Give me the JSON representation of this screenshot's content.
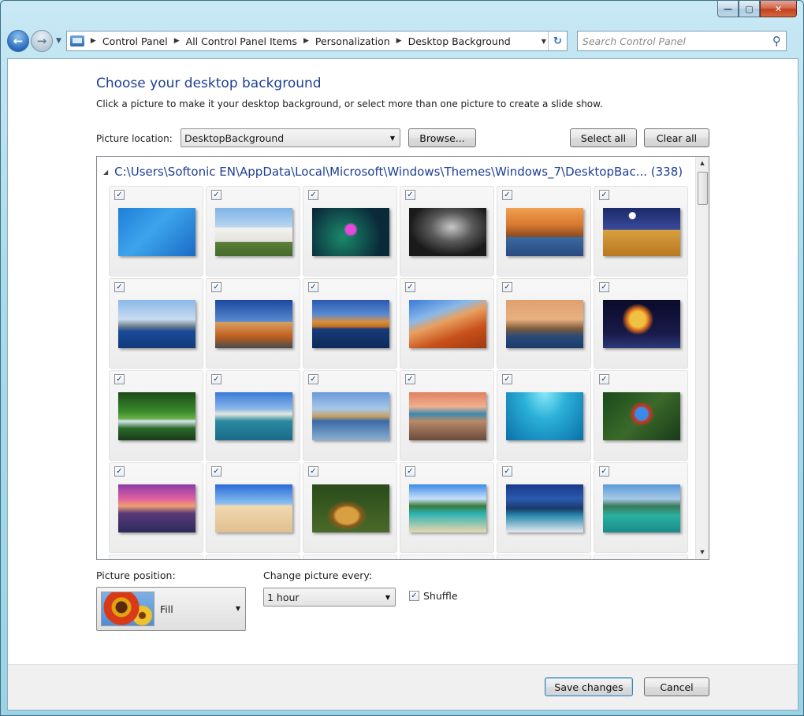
{
  "window": {
    "minimize_glyph": "—",
    "maximize_glyph": "▢",
    "close_glyph": "✕"
  },
  "nav": {
    "back_glyph": "←",
    "forward_glyph": "→",
    "breadcrumbs": [
      "Control Panel",
      "All Control Panel Items",
      "Personalization",
      "Desktop Background"
    ],
    "search_placeholder": "Search Control Panel"
  },
  "page": {
    "heading": "Choose your desktop background",
    "subtext": "Click a picture to make it your desktop background, or select more than one picture to create a slide show.",
    "picture_location_label": "Picture location:",
    "picture_location_value": "DesktopBackground",
    "browse_label": "Browse...",
    "select_all_label": "Select all",
    "clear_all_label": "Clear all"
  },
  "gallery": {
    "group_path": "C:\\Users\\Softonic EN\\AppData\\Local\\Microsoft\\Windows\\Themes\\Windows_7\\DesktopBac... (338)",
    "check_glyph": "✓",
    "thumbnails": [
      {
        "name": "windows-logo-thumbnail",
        "bg": "linear-gradient(135deg,#1f7fd8 0%,#3da4ec 45%,#1a6bc6 100%)"
      },
      {
        "name": "white-houses-thumbnail",
        "bg": "linear-gradient(180deg,#7fb2e6 0%,#b9d6f0 40%,#f2f2f0 41%,#e4e2dc 70%,#5b7f3a 71%,#456a2a 100%)"
      },
      {
        "name": "neon-light-thumbnail",
        "bg": "radial-gradient(circle at 50% 45%,#e64adc 0 6px,transparent 9px),radial-gradient(circle at 40% 60%,#1a8a6a,#0a2a3a 70%)"
      },
      {
        "name": "dark-curve-thumbnail",
        "bg": "radial-gradient(ellipse at 55% 40%,#c8c8c8 0%,#5a5a5a 35%,#1a1a1a 70%)"
      },
      {
        "name": "coastal-rocks-thumbnail",
        "bg": "linear-gradient(180deg,#f0a050 0%,#d87830 35%,#8a4a20 60%,#3a6aa0 61%,#2a4a80 100%)"
      },
      {
        "name": "desert-pinnacles-thumbnail",
        "bg": "radial-gradient(circle at 38% 16%,#ffffff 0 4px,transparent 5px),linear-gradient(180deg,#1a2a6a 0%,#3a4a9a 45%,#d8a040 46%,#b87820 100%)"
      },
      {
        "name": "city-harbor-thumbnail",
        "bg": "linear-gradient(180deg,#8ab8e8 0%,#c8dcef 40%,#6a7a8a 55%,#1a4a9a 65%,#123a7a 100%)"
      },
      {
        "name": "outback-road-thumbnail",
        "bg": "linear-gradient(180deg,#1a4aa0 0%,#5a8ad0 45%,#d8a060 46%,#c06020 75%,#4a4a4a 100%)"
      },
      {
        "name": "lake-reflection-thumbnail",
        "bg": "linear-gradient(180deg,#2a5ab0 0%,#5a8ad0 30%,#d89040 45%,#c07020 55%,#1a3a7a 60%,#0a2a5a 100%)"
      },
      {
        "name": "red-dunes-thumbnail",
        "bg": "linear-gradient(160deg,#3a7ad8 0%,#8ab8e8 30%,#e8a060 45%,#c8501a 70%,#a03a10 100%)"
      },
      {
        "name": "baobab-trees-thumbnail",
        "bg": "linear-gradient(180deg,#e0a070 0%,#e8b080 40%,#7a5a3a 60%,#2a4a7a 75%,#1a3a6a 100%)"
      },
      {
        "name": "fireworks-thumbnail",
        "bg": "radial-gradient(circle at 45% 40%,#f0c040 0 10px,#d86a1a 14px,transparent 20px),linear-gradient(180deg,#0a0a2a 0%,#1a1a4a 70%,#2a3a7a 100%)"
      },
      {
        "name": "rainforest-stream-thumbnail",
        "bg": "linear-gradient(180deg,#1a4a1a 0%,#3a8a2a 40%,#6ab04a 55%,#d8e8f0 60%,#2a6a2a 75%,#1a3a1a 100%)"
      },
      {
        "name": "sydney-harbor-thumbnail",
        "bg": "linear-gradient(180deg,#3a7ad8 0%,#8ab8e8 35%,#e8e8e0 45%,#2a8aa0 60%,#1a6a8a 100%)"
      },
      {
        "name": "apostles-coast-thumbnail",
        "bg": "linear-gradient(180deg,#6a9ad8 0%,#a8c8e8 35%,#c8a060 50%,#3a6aa8 60%,#8ab0d0 100%)"
      },
      {
        "name": "rocky-shore-thumbnail",
        "bg": "linear-gradient(180deg,#e08060 0%,#f0b090 30%,#3a8ab0 45%,#b88a6a 60%,#6a4a3a 100%)"
      },
      {
        "name": "underwater-thumbnail",
        "bg": "radial-gradient(ellipse at 50% 0%,#8ae8f8 0%,#2ab0d8 40%,#0a70a8 100%)"
      },
      {
        "name": "parrot-thumbnail",
        "bg": "radial-gradient(circle at 50% 45%,#3a8ae8 0 8px,#d83020 10px,transparent 16px),linear-gradient(135deg,#1a4a1a 0%,#3a6a2a 50%,#1a3a1a 100%)"
      },
      {
        "name": "sunset-bay-thumbnail",
        "bg": "linear-gradient(180deg,#8a3aa8 0%,#e060a0 30%,#f0a070 45%,#5a3a7a 60%,#2a2a5a 100%)"
      },
      {
        "name": "sand-palms-thumbnail",
        "bg": "linear-gradient(180deg,#2a6ad8 0%,#8ac0f0 40%,#f0d8b0 45%,#e0c090 100%)"
      },
      {
        "name": "leopard-thumbnail",
        "bg": "radial-gradient(ellipse at 45% 65%,#d8a040 0 14px,#8a5a1a 18px,transparent 26px),linear-gradient(180deg,#2a4a1a 0%,#4a6a2a 100%)"
      },
      {
        "name": "tropical-beach-thumbnail",
        "bg": "linear-gradient(180deg,#3a8ae8 0%,#c8e0f8 30%,#3a7a3a 45%,#2ab0b0 60%,#e8d8b0 100%)"
      },
      {
        "name": "coastal-city-thumbnail",
        "bg": "linear-gradient(180deg,#1a3a8a 0%,#2a5ab0 30%,#1a3a6a 50%,#2a8ab0 65%,#e8e8f0 100%)"
      },
      {
        "name": "island-lagoon-thumbnail",
        "bg": "linear-gradient(180deg,#5a9ad8 0%,#a8c8e8 30%,#3a7a5a 45%,#2ab0a0 65%,#1a8a8a 100%)"
      }
    ]
  },
  "options": {
    "picture_position_label": "Picture position:",
    "picture_position_value": "Fill",
    "change_every_label": "Change picture every:",
    "change_every_value": "1 hour",
    "shuffle_label": "Shuffle",
    "shuffle_checked": true
  },
  "footer": {
    "save_label": "Save changes",
    "cancel_label": "Cancel"
  }
}
